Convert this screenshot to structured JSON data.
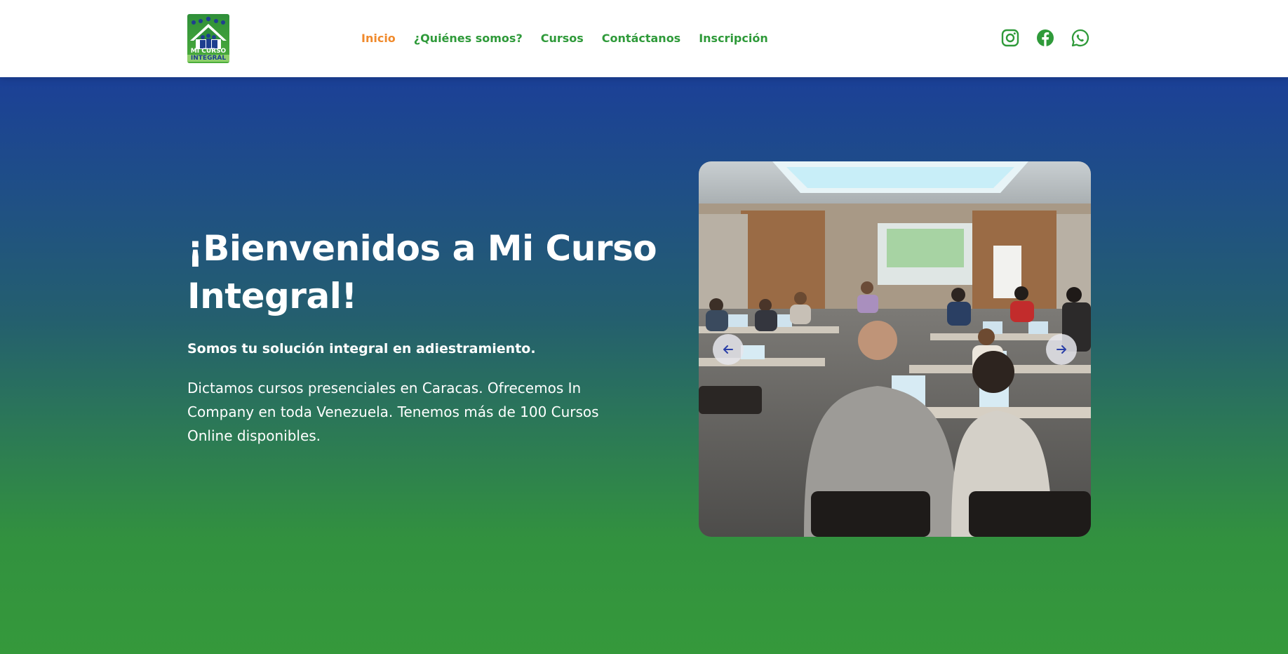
{
  "brand": {
    "logo_line1": "MI CURSO",
    "logo_line2": "INTEGRAL",
    "logo_alt": "Mi Curso Integral"
  },
  "nav": {
    "items": [
      {
        "label": "Inicio",
        "active": true
      },
      {
        "label": "¿Quiénes somos?",
        "active": false
      },
      {
        "label": "Cursos",
        "active": false
      },
      {
        "label": "Contáctanos",
        "active": false
      },
      {
        "label": "Inscripción",
        "active": false
      }
    ]
  },
  "social": {
    "icons": [
      "instagram-icon",
      "facebook-icon",
      "whatsapp-icon"
    ]
  },
  "hero": {
    "title": "¡Bienvenidos a Mi Curso Integral!",
    "subtitle": "Somos tu solución integral en adiestramiento.",
    "body": "Dictamos cursos presenciales en Caracas. Ofrecemos In Company en toda Venezuela. Tenemos más de 100 Cursos Online disponibles."
  },
  "carousel": {
    "prev_icon": "arrow-left-icon",
    "next_icon": "arrow-right-icon"
  },
  "colors": {
    "nav_text": "#2f9a3a",
    "nav_active": "#f08a2c",
    "hero_top": "#1b4097",
    "hero_bottom": "#35993b",
    "carousel_arrow": "#2a3fa8"
  }
}
